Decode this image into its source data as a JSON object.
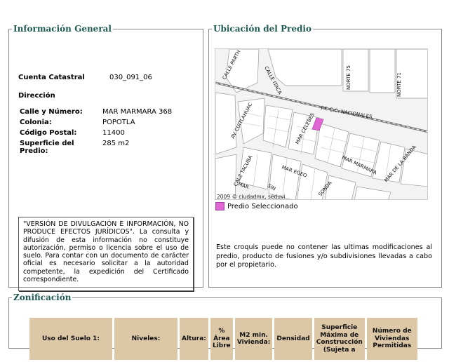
{
  "general": {
    "legend": "Información General",
    "cuenta_label": "Cuenta Catastral",
    "cuenta_value": "030_091_06",
    "direccion_label": "Dirección",
    "fields": [
      {
        "label": "Calle y Número:",
        "value": "MAR MARMARA 368"
      },
      {
        "label": "Colonia:",
        "value": "POPOTLA"
      },
      {
        "label": "Código Postal:",
        "value": "11400"
      },
      {
        "label": "Superficie del Predio:",
        "value": "285 m2"
      }
    ],
    "disclaimer": "\"VERSIÓN DE DIVULGACIÓN E INFORMACIÓN, NO PRODUCE EFECTOS JURÍDICOS\". La consulta y difusión de esta información no constituye autorización, permiso o licencia sobre el uso de suelo. Para contar con un documento de carácter oficial es necesario solicitar a la autoridad competente, la expedición del Certificado correspondiente."
  },
  "ubicacion": {
    "legend": "Ubicación del Predio",
    "map_copyright": "2009 © ciudadmx, seduvi",
    "street_labels": [
      "CALLE PARTH",
      "CALLE ITACA",
      "NORTE 75",
      "NORTE 71",
      "AV CUITLAHUAC",
      "MAR CELEBES",
      "F.F. C.C. NACIONALES",
      "MAR MARMARA",
      "MAR DE LA BANDA",
      "CALZ TACUBA",
      "MAR EGEO",
      "SONDA",
      "MAR",
      "SIN"
    ],
    "legend_label": "Predio Seleccionado",
    "selected_color": "#e066d4",
    "note": "Este croquis puede no contener las ultimas modificaciones al predio, producto de fusiones y/o subdivisiones llevadas a cabo por el propietario."
  },
  "zonificacion": {
    "legend": "Zonificación",
    "headers": [
      "Uso del Suelo 1:",
      "Niveles:",
      "Altura:",
      "% Área Libre",
      "M2 min. Vivienda:",
      "Densidad",
      "Superficie Máxima de Construcción (Sujeta a",
      "Número de Viviendas Permitidas"
    ]
  }
}
